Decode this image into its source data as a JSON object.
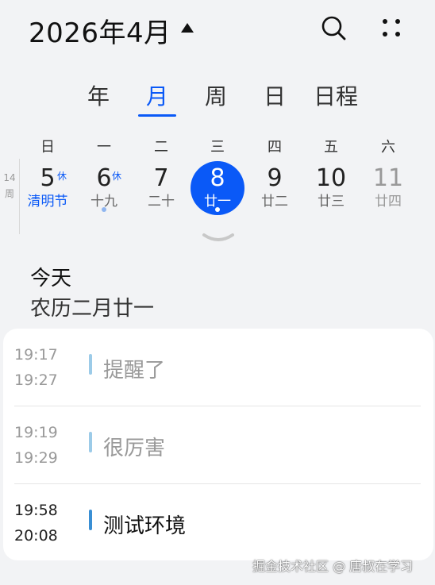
{
  "header": {
    "title": "2026年4月"
  },
  "view_tabs": [
    "年",
    "月",
    "周",
    "日",
    "日程"
  ],
  "active_tab": "月",
  "weekdays": [
    "日",
    "一",
    "二",
    "三",
    "四",
    "五",
    "六"
  ],
  "week": {
    "number": "14",
    "unit": "周",
    "days": [
      {
        "day": "5",
        "mark": "休",
        "lunar": "清明节",
        "holiday": true,
        "has_event": false,
        "selected": false,
        "muted": false
      },
      {
        "day": "6",
        "mark": "休",
        "lunar": "十九",
        "holiday": false,
        "has_event": true,
        "selected": false,
        "muted": false
      },
      {
        "day": "7",
        "mark": "",
        "lunar": "二十",
        "holiday": false,
        "has_event": false,
        "selected": false,
        "muted": false
      },
      {
        "day": "8",
        "mark": "",
        "lunar": "廿一",
        "holiday": false,
        "has_event": true,
        "selected": true,
        "muted": false
      },
      {
        "day": "9",
        "mark": "",
        "lunar": "廿二",
        "holiday": false,
        "has_event": false,
        "selected": false,
        "muted": false
      },
      {
        "day": "10",
        "mark": "",
        "lunar": "廿三",
        "holiday": false,
        "has_event": false,
        "selected": false,
        "muted": false
      },
      {
        "day": "11",
        "mark": "",
        "lunar": "廿四",
        "holiday": false,
        "has_event": false,
        "selected": false,
        "muted": true
      }
    ]
  },
  "today": {
    "label": "今天",
    "lunar": "农历二月廿一"
  },
  "events": [
    {
      "start": "19:17",
      "end": "19:27",
      "title": "提醒了",
      "past": true
    },
    {
      "start": "19:19",
      "end": "19:29",
      "title": "很厉害",
      "past": true
    },
    {
      "start": "19:58",
      "end": "20:08",
      "title": "测试环境",
      "past": false
    }
  ],
  "watermark": "掘金技术社区 @ 唐叔在学习",
  "colors": {
    "accent": "#0a59f7",
    "background": "#f2f3f5",
    "card": "#ffffff",
    "event_bar_past": "#9ccbe8",
    "event_bar_current": "#3a8fd4"
  },
  "icons": {
    "title_caret": "caret-up-icon",
    "search": "search-icon",
    "more": "more-grid-icon",
    "expand": "chevron-down-icon"
  }
}
